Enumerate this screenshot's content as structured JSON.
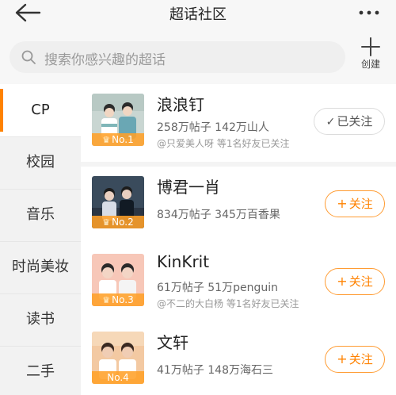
{
  "header": {
    "title": "超话社区",
    "back_icon": "back-arrow-icon",
    "more_icon": "more-dots-icon"
  },
  "search": {
    "placeholder": "搜索你感兴趣的超话",
    "create_label": "创建"
  },
  "sidebar": {
    "items": [
      {
        "label": "CP",
        "active": true
      },
      {
        "label": "校园",
        "active": false
      },
      {
        "label": "音乐",
        "active": false
      },
      {
        "label": "时尚美妆",
        "active": false
      },
      {
        "label": "读书",
        "active": false
      },
      {
        "label": "二手",
        "active": false
      }
    ]
  },
  "list": {
    "items": [
      {
        "name": "浪浪钉",
        "stats": "258万帖子 142万山人",
        "friends": "@只爱美人呀 等1名好友已关注",
        "rank": "No.1",
        "button": "已关注",
        "followed": true
      },
      {
        "name": "博君一肖",
        "stats": "834万帖子 345万百香果",
        "friends": "",
        "rank": "No.2",
        "button": "关注",
        "followed": false
      },
      {
        "name": "KinKrit",
        "stats": "61万帖子 51万penguin",
        "friends": "@不二的大白杨 等1名好友已关注",
        "rank": "No.3",
        "button": "关注",
        "followed": false
      },
      {
        "name": "文轩",
        "stats": "41万帖子 148万海石三",
        "friends": "",
        "rank": "No.4",
        "button": "关注",
        "followed": false
      }
    ]
  },
  "colors": {
    "accent": "#ff8200",
    "rank_badge": "#ffa028"
  }
}
